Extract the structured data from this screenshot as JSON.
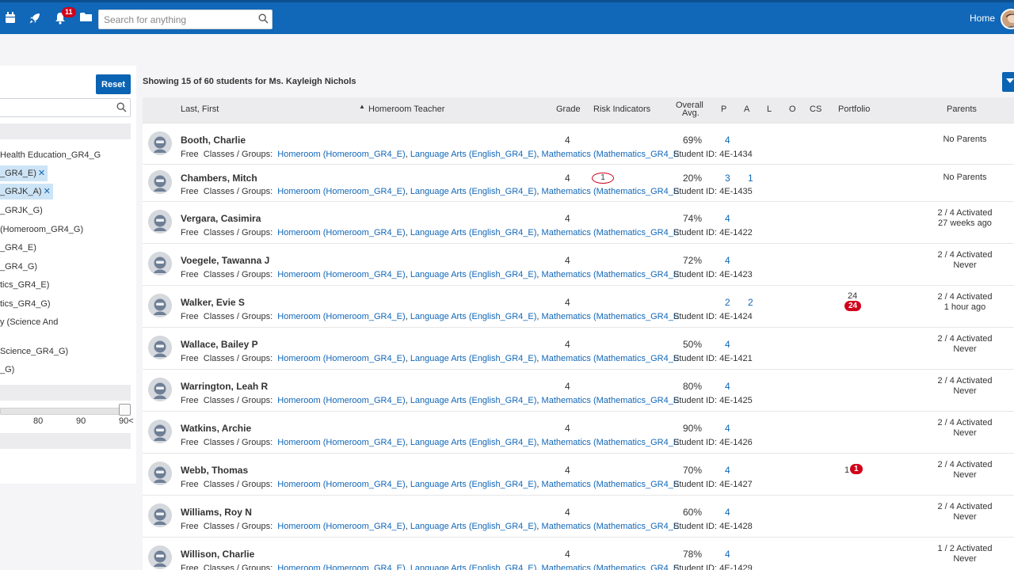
{
  "nav": {
    "notifications_count": "11",
    "search_placeholder": "Search for anything",
    "home_label": "Home"
  },
  "filters": {
    "reset_label": "Reset",
    "items": [
      "Health Education_GR4_G",
      "_GR4_E)",
      "_GRJK_A)",
      "_GRJK_G)",
      "(Homeroom_GR4_G)",
      "_GR4_E)",
      "_GR4_G)",
      "tics_GR4_E)",
      "tics_GR4_G)",
      "y (Science And",
      "Science_GR4_G)",
      "_G)"
    ],
    "slider_labels": [
      "80",
      "90",
      "90<"
    ]
  },
  "main": {
    "showing_text": "Showing 15 of 60 students for Ms. Kayleigh Nichols",
    "headers": {
      "name": "Last, First",
      "teacher": "Homeroom Teacher",
      "grade": "Grade",
      "risk": "Risk Indicators",
      "avg_line1": "Overall",
      "avg_line2": "Avg.",
      "p": "P",
      "a": "A",
      "l": "L",
      "o": "O",
      "cs": "CS",
      "portfolio": "Portfolio",
      "parents": "Parents"
    },
    "row_labels": {
      "free": "Free",
      "classes": "Classes / Groups:",
      "homeroom": "Homeroom (Homeroom_GR4_E)",
      "language": "Language Arts (English_GR4_E)",
      "math": "Mathematics (Mathematics_GR4_E",
      "student_id": "Student ID:",
      "separator": ","
    },
    "students": [
      {
        "name": "Booth, Charlie",
        "grade": "4",
        "risk": "",
        "avg": "69%",
        "p": "4",
        "a": "",
        "portfolio": "",
        "portfolio_badge": "",
        "id": "4E-1434",
        "parents1": "No Parents",
        "parents2": ""
      },
      {
        "name": "Chambers, Mitch",
        "grade": "4",
        "risk": "1",
        "avg": "20%",
        "p": "3",
        "a": "1",
        "portfolio": "",
        "portfolio_badge": "",
        "id": "4E-1435",
        "parents1": "No Parents",
        "parents2": ""
      },
      {
        "name": "Vergara, Casimira",
        "grade": "4",
        "risk": "",
        "avg": "74%",
        "p": "4",
        "a": "",
        "portfolio": "",
        "portfolio_badge": "",
        "id": "4E-1422",
        "parents1": "2 / 4 Activated",
        "parents2": "27 weeks ago"
      },
      {
        "name": "Voegele, Tawanna J",
        "grade": "4",
        "risk": "",
        "avg": "72%",
        "p": "4",
        "a": "",
        "portfolio": "",
        "portfolio_badge": "",
        "id": "4E-1423",
        "parents1": "2 / 4 Activated",
        "parents2": "Never"
      },
      {
        "name": "Walker, Evie S",
        "grade": "4",
        "risk": "",
        "avg": "",
        "p": "2",
        "a": "2",
        "portfolio": "24",
        "portfolio_badge": "24",
        "id": "4E-1424",
        "parents1": "2 / 4 Activated",
        "parents2": "1 hour ago"
      },
      {
        "name": "Wallace, Bailey P",
        "grade": "4",
        "risk": "",
        "avg": "50%",
        "p": "4",
        "a": "",
        "portfolio": "",
        "portfolio_badge": "",
        "id": "4E-1421",
        "parents1": "2 / 4 Activated",
        "parents2": "Never"
      },
      {
        "name": "Warrington, Leah R",
        "grade": "4",
        "risk": "",
        "avg": "80%",
        "p": "4",
        "a": "",
        "portfolio": "",
        "portfolio_badge": "",
        "id": "4E-1425",
        "parents1": "2 / 4 Activated",
        "parents2": "Never"
      },
      {
        "name": "Watkins, Archie",
        "grade": "4",
        "risk": "",
        "avg": "90%",
        "p": "4",
        "a": "",
        "portfolio": "",
        "portfolio_badge": "",
        "id": "4E-1426",
        "parents1": "2 / 4 Activated",
        "parents2": "Never"
      },
      {
        "name": "Webb, Thomas",
        "grade": "4",
        "risk": "",
        "avg": "70%",
        "p": "4",
        "a": "",
        "portfolio": "1",
        "portfolio_badge": "1",
        "id": "4E-1427",
        "parents1": "2 / 4 Activated",
        "parents2": "Never"
      },
      {
        "name": "Williams, Roy N",
        "grade": "4",
        "risk": "",
        "avg": "60%",
        "p": "4",
        "a": "",
        "portfolio": "",
        "portfolio_badge": "",
        "id": "4E-1428",
        "parents1": "2 / 4 Activated",
        "parents2": "Never"
      },
      {
        "name": "Willison, Charlie",
        "grade": "4",
        "risk": "",
        "avg": "78%",
        "p": "4",
        "a": "",
        "portfolio": "",
        "portfolio_badge": "",
        "id": "4E-1429",
        "parents1": "1 / 2 Activated",
        "parents2": "Never"
      }
    ]
  },
  "colors": {
    "nav_blue": "#1167b8",
    "link_blue": "#1167b8",
    "alert_red": "#d0021b",
    "chip_blue": "#cde4f6"
  },
  "icons": {
    "calendar": "calendar-icon",
    "rocket": "rocket-icon",
    "bell": "bell-icon",
    "folder": "folder-icon",
    "search": "search-icon",
    "avatar": "avatar-icon",
    "remove": "close-icon"
  }
}
